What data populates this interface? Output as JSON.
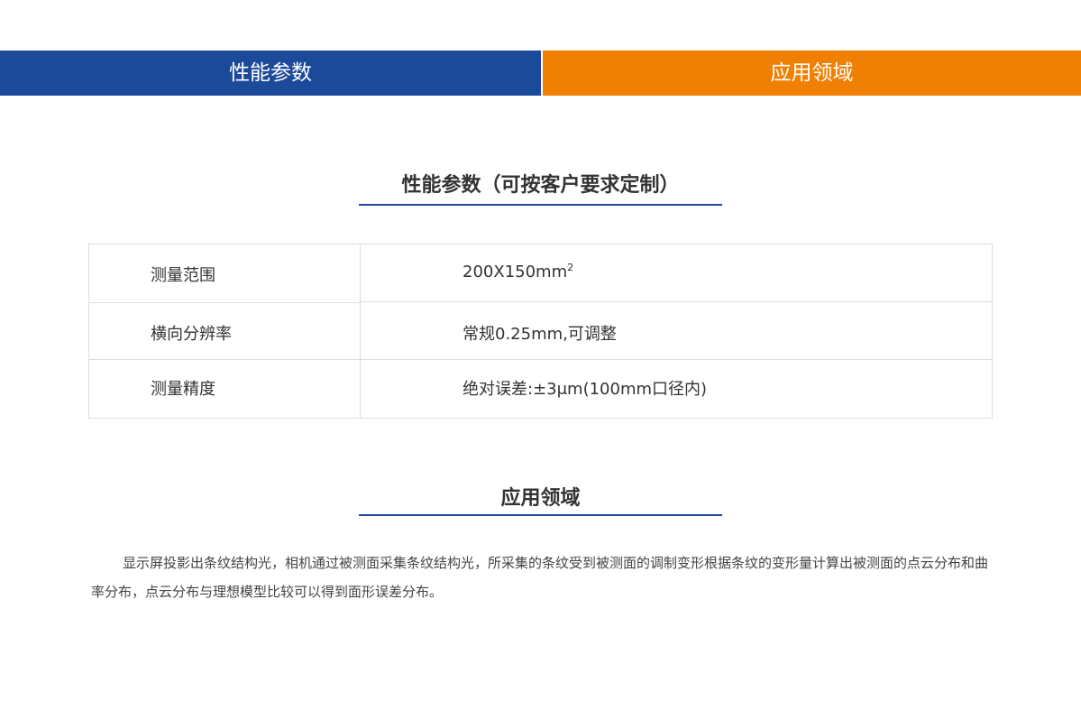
{
  "tabs": [
    {
      "label": "性能参数",
      "color": "#1c4a9b"
    },
    {
      "label": "应用领域",
      "color": "#ef8003"
    }
  ],
  "params_section": {
    "title": "性能参数（可按客户要求定制）",
    "underline_color": "#1c4a9b"
  },
  "spec_table": {
    "rows": [
      {
        "label": "测量范围",
        "value": "200X150mm",
        "value_sup": "2"
      },
      {
        "label": "横向分辨率",
        "value": "常规0.25mm,可调整"
      },
      {
        "label": "测量精度",
        "value": "绝对误差:±3μm(100mm口径内)"
      }
    ]
  },
  "apps_section": {
    "title": "应用领域",
    "underline_color": "#1c4a9b",
    "description": "显示屏投影出条纹结构光，相机通过被测面采集条纹结构光，所采集的条纹受到被测面的调制变形根据条纹的变形量计算出被测面的点云分布和曲率分布，点云分布与理想模型比较可以得到面形误差分布。"
  }
}
